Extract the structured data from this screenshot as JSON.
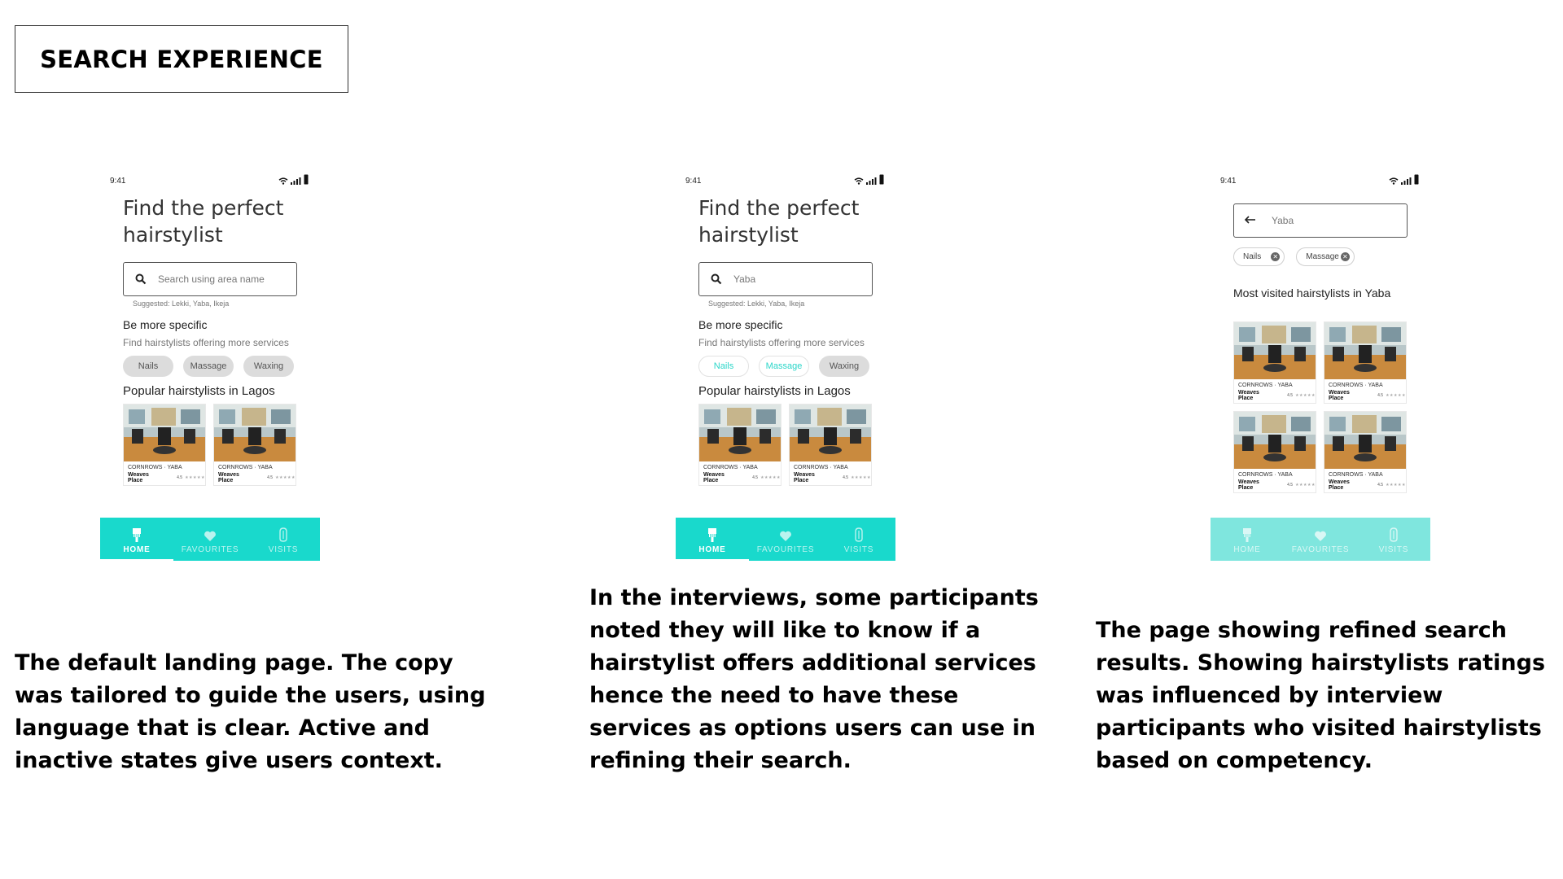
{
  "page_title": "SEARCH EXPERIENCE",
  "status_time": "9:41",
  "screens": [
    {
      "heading": "Find the perfect hairstylist",
      "search_value": "Search using area name",
      "suggested": "Suggested: Lekki, Yaba, Ikeja",
      "section_title": "Be more specific",
      "section_sub": "Find hairstylists offering more services",
      "chips": [
        {
          "label": "Nails",
          "active": false
        },
        {
          "label": "Massage",
          "active": false
        },
        {
          "label": "Waxing",
          "active": false
        }
      ],
      "popular_title": "Popular hairstylists in Lagos",
      "cards": [
        {
          "category": "CORNROWS · YABA",
          "name": "Weaves Place",
          "rating": "4.5"
        },
        {
          "category": "CORNROWS · YABA",
          "name": "Weaves Place",
          "rating": "4.5"
        }
      ]
    },
    {
      "heading": "Find the perfect hairstylist",
      "search_value": "Yaba",
      "suggested": "Suggested: Lekki, Yaba, Ikeja",
      "section_title": "Be more specific",
      "section_sub": "Find hairstylists offering more services",
      "chips": [
        {
          "label": "Nails",
          "active": true
        },
        {
          "label": "Massage",
          "active": true
        },
        {
          "label": "Waxing",
          "active": false
        }
      ],
      "popular_title": "Popular hairstylists in Lagos",
      "cards": [
        {
          "category": "CORNROWS · YABA",
          "name": "Weaves Place",
          "rating": "4.5"
        },
        {
          "category": "CORNROWS · YABA",
          "name": "Weaves Place",
          "rating": "4.5"
        }
      ]
    },
    {
      "search_value": "Yaba",
      "filters": [
        "Nails",
        "Massage"
      ],
      "results_title": "Most visited hairstylists in Yaba",
      "cards": [
        {
          "category": "CORNROWS · YABA",
          "name": "Weaves Place",
          "rating": "4.5"
        },
        {
          "category": "CORNROWS · YABA",
          "name": "Weaves Place",
          "rating": "4.5"
        },
        {
          "category": "CORNROWS · YABA",
          "name": "Weaves Place",
          "rating": "4.5"
        },
        {
          "category": "CORNROWS · YABA",
          "name": "Weaves Place",
          "rating": "4.5"
        }
      ]
    }
  ],
  "tabbar": {
    "home": "HOME",
    "favourites": "FAVOURITES",
    "visits": "VISITS"
  },
  "icons": {
    "home": "comb-icon",
    "favourites": "heart-icon",
    "visits": "hair-clip-icon"
  },
  "colors": {
    "accent": "#19d9cc",
    "accent_faded": "#7fe6de",
    "chip_inactive": "#dcdcdc",
    "chip_active_text": "#2ad6c9"
  },
  "captions": [
    "The default landing page. The copy was tailored to guide the users, using language that is clear. Active and inactive states give users context.",
    "In the interviews, some participants noted they will like to know if a hairstylist offers additional services hence the need to have these services as options users can use in refining their search.",
    "The page showing refined search results. Showing hairstylists ratings was influenced by interview participants who visited hairstylists based on competency."
  ]
}
